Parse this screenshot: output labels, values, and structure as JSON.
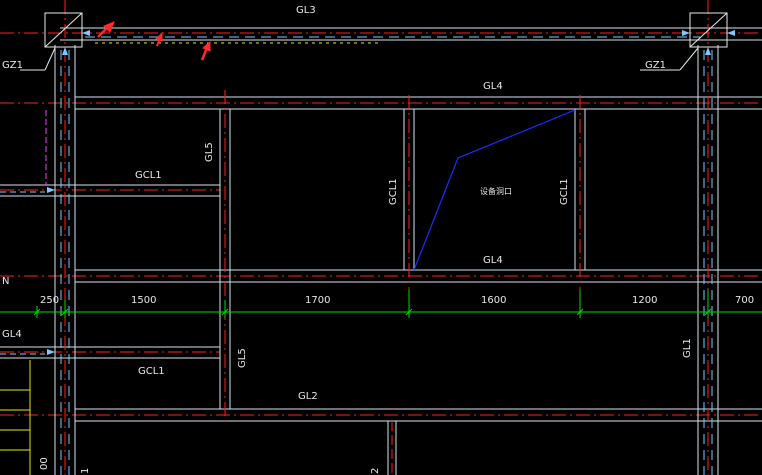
{
  "drawing": {
    "labels": {
      "gl3": "GL3",
      "gz1_left": "GZ1",
      "gz1_right": "GZ1",
      "gl4_top": "GL4",
      "gl5_upper": "GL5",
      "gcl1_upper": "GCL1",
      "gcl1_vert_left": "GCL1",
      "gcl1_vert_right": "GCL1",
      "opening": "设备洞口",
      "gl4_mid": "GL4",
      "n_mark": "N",
      "gl4_left": "GL4",
      "gcl1_lower": "GCL1",
      "gl5_lower": "GL5",
      "gl1": "GL1",
      "gl2": "GL2",
      "frag_bottom_left": "00",
      "frag_bottom_a": "1",
      "frag_bottom_b": "2"
    },
    "dimensions": [
      "250",
      "1500",
      "1700",
      "1600",
      "1200",
      "700"
    ],
    "colors": {
      "background": "#000000",
      "beam_edge": "#cfe3ee",
      "centerline": "#ff2020",
      "hidden_line": "#7ec8ff",
      "dimension_line": "#00dd00",
      "opening_line": "#1a2cff",
      "annotation_arrow": "#ff2a2a",
      "magenta_line": "#ff33ff",
      "yellow_line": "#e8e800"
    }
  }
}
